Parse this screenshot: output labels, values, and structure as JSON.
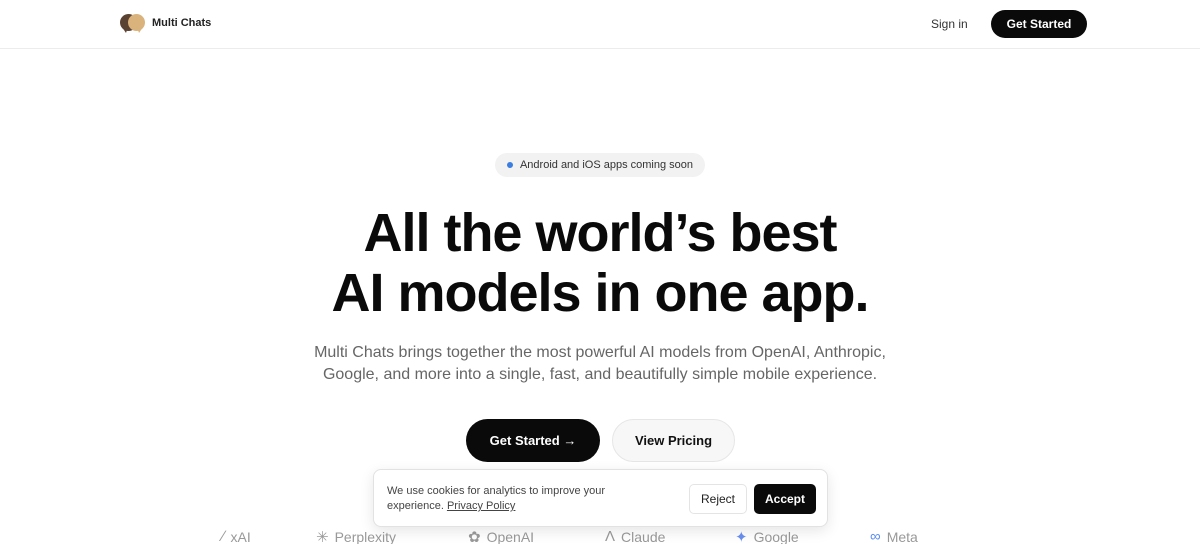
{
  "nav": {
    "brand": "Multi Chats",
    "sign_in": "Sign in",
    "get_started": "Get Started"
  },
  "hero": {
    "badge": "Android and iOS apps coming soon",
    "headline_line1": "All the world’s best",
    "headline_line2": "AI models in one app.",
    "subtitle": "Multi Chats brings together the most powerful AI models from OpenAI, Anthropic, Google, and more into a single, fast, and beautifully simple mobile experience.",
    "cta_primary": "Get Started →",
    "cta_secondary": "View Pricing"
  },
  "providers": [
    {
      "name": "xAI",
      "icon": "xai-icon",
      "glyph": "∕"
    },
    {
      "name": "Perplexity",
      "icon": "perplexity-icon",
      "glyph": "✳"
    },
    {
      "name": "OpenAI",
      "icon": "openai-icon",
      "glyph": "✿"
    },
    {
      "name": "Claude",
      "icon": "claude-icon",
      "glyph": "Λ"
    },
    {
      "name": "Google",
      "icon": "google-icon",
      "glyph": "✦"
    },
    {
      "name": "Meta",
      "icon": "meta-icon",
      "glyph": "∞"
    }
  ],
  "cookie": {
    "message": "We use cookies for analytics to improve your experience.",
    "link": "Privacy Policy",
    "reject": "Reject",
    "accept": "Accept"
  },
  "colors": {
    "accent_dot": "#3b7de0",
    "primary": "#0a0a0a",
    "meta_blue": "#5b8def",
    "google_blue": "#6a8ff0"
  }
}
